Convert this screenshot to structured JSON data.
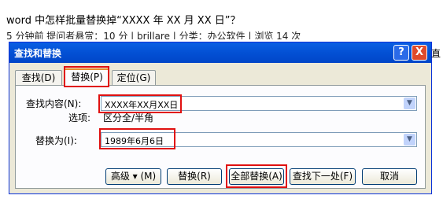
{
  "background": {
    "question": "word 中怎样批量替换掉“XXXX 年 XX 月 XX 日”？",
    "meta": "5 分钟前 提问者悬赏：10 分 | brillare | 分类：办公软件 | 浏览 14 次",
    "right_fragment": "直"
  },
  "dialog": {
    "title": "查找和替换",
    "help_label": "?",
    "close_label": "X",
    "tabs": [
      {
        "label": "查找(D)",
        "selected": false
      },
      {
        "label": "替换(P)",
        "selected": true
      },
      {
        "label": "定位(G)",
        "selected": false
      }
    ],
    "find": {
      "label": "查找内容(N):",
      "value": "XXXX年XX月XX日"
    },
    "options": {
      "label": "选项:",
      "value": "区分全/半角"
    },
    "replace": {
      "label": "替换为(I):",
      "value": "1989年6月6日"
    },
    "buttons": {
      "more": "高级 ▾ (M)",
      "replace": "替换(R)",
      "replace_all": "全部替换(A)",
      "find_next": "查找下一处(F)",
      "cancel": "取消"
    }
  },
  "colors": {
    "title_bar": "#0350d4",
    "dialog_bg": "#ece9d8",
    "highlight": "#e01010"
  }
}
